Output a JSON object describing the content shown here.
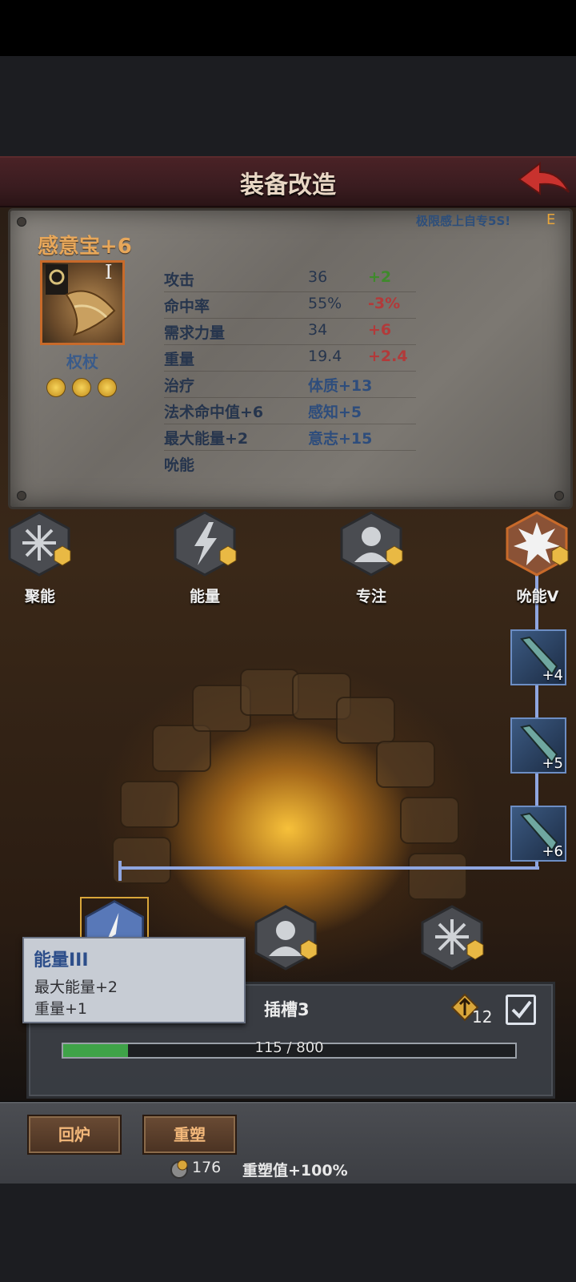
{
  "header": {
    "title": "装备改造"
  },
  "item": {
    "name": "感意宝+6",
    "tier": "I",
    "type": "权杖",
    "gem_count": 3,
    "promo": "极限感上自专5S!",
    "promo_badge": "E"
  },
  "stats": [
    {
      "name": "攻击",
      "value": "36",
      "delta": "+2",
      "trend": "up"
    },
    {
      "name": "命中率",
      "value": "55%",
      "delta": "-3%",
      "trend": "down"
    },
    {
      "name": "需求力量",
      "value": "34",
      "delta": "+6",
      "trend": "down"
    },
    {
      "name": "重量",
      "value": "19.4",
      "delta": "+2.4",
      "trend": "down"
    },
    {
      "name": "治疗",
      "value": "体质+13",
      "delta": "",
      "trend": "attr"
    },
    {
      "name": "法术命中值+6",
      "value": "感知+5",
      "delta": "",
      "trend": "attr"
    },
    {
      "name": "最大能量+2",
      "value": "意志+15",
      "delta": "",
      "trend": "attr"
    },
    {
      "name": "吮能",
      "value": "",
      "delta": "",
      "trend": ""
    }
  ],
  "skills": [
    {
      "label": "聚能",
      "icon": "burst-icon"
    },
    {
      "label": "能量",
      "icon": "lightning-icon"
    },
    {
      "label": "专注",
      "icon": "person-icon"
    },
    {
      "label": "吮能V",
      "icon": "explosion-icon"
    }
  ],
  "upgrade_slots": [
    {
      "level": "+4"
    },
    {
      "level": "+5"
    },
    {
      "level": "+6"
    }
  ],
  "tooltip": {
    "title": "能量III",
    "line1": "最大能量+2",
    "line2": "重量+1"
  },
  "slot": {
    "title": "插槽3",
    "cost": "12",
    "progress_text": "115 / 800",
    "progress_current": 115,
    "progress_max": 800
  },
  "buttons": {
    "recycle": "回炉",
    "reshape": "重塑"
  },
  "footer": {
    "coins": "176",
    "reshape_value": "重塑值+100%"
  },
  "colors": {
    "header": "#3a1c20",
    "accent": "#e7a75a",
    "progress": "#3fa348"
  }
}
